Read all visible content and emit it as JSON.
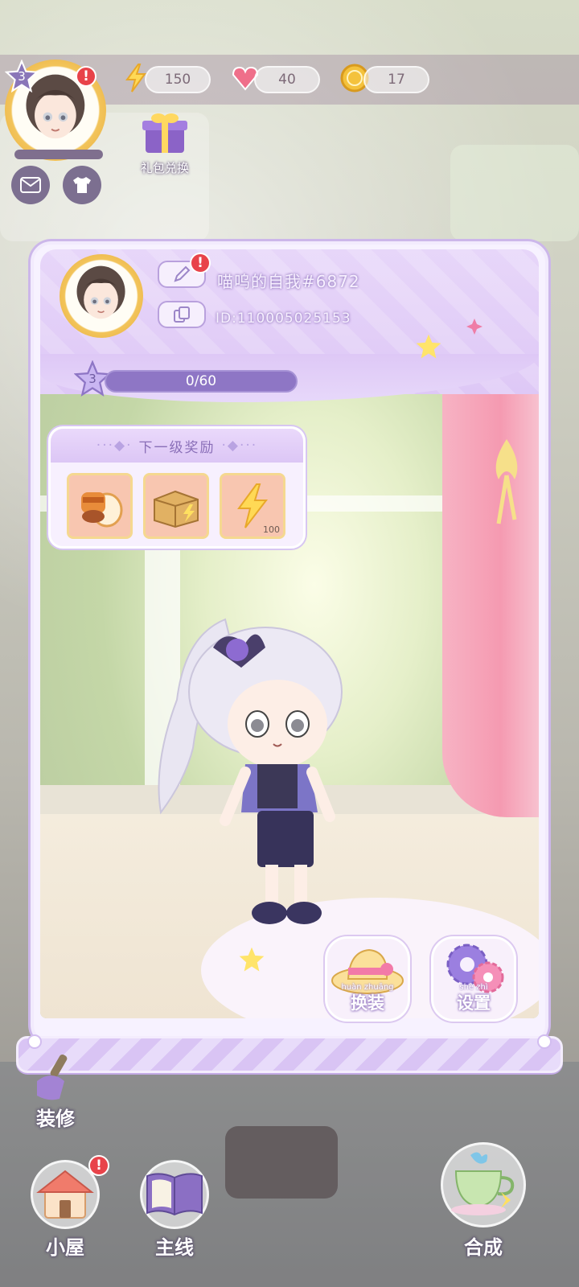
{
  "hud": {
    "player_level": "3",
    "energy": "150",
    "gems": "40",
    "coins": "17",
    "gift_redeem_label": "礼包兑换"
  },
  "profile": {
    "nickname": "喵呜的自我#6872",
    "player_id": "ID:110005025153",
    "level": "3",
    "exp_text": "0/60",
    "exp_fraction": 0
  },
  "rewards": {
    "title": "下一级奖励",
    "items": [
      {
        "icon": "cookie-food-icon",
        "qty": ""
      },
      {
        "icon": "cardboard-box-icon",
        "qty": ""
      },
      {
        "icon": "lightning-energy-icon",
        "qty": "100"
      }
    ]
  },
  "actions": {
    "dress_up": {
      "label": "换装",
      "pinyin": "huàn zhuāng"
    },
    "settings": {
      "label": "设置",
      "pinyin": "shè zhì"
    }
  },
  "nav": {
    "decorate": "装修",
    "cabin": "小屋",
    "main_story": "主线",
    "merge": "合成"
  },
  "colors": {
    "panel_lilac": "#dec8f6",
    "accent_purple": "#8e76c5",
    "alert_red": "#e8434a",
    "gold": "#f2c45a"
  }
}
